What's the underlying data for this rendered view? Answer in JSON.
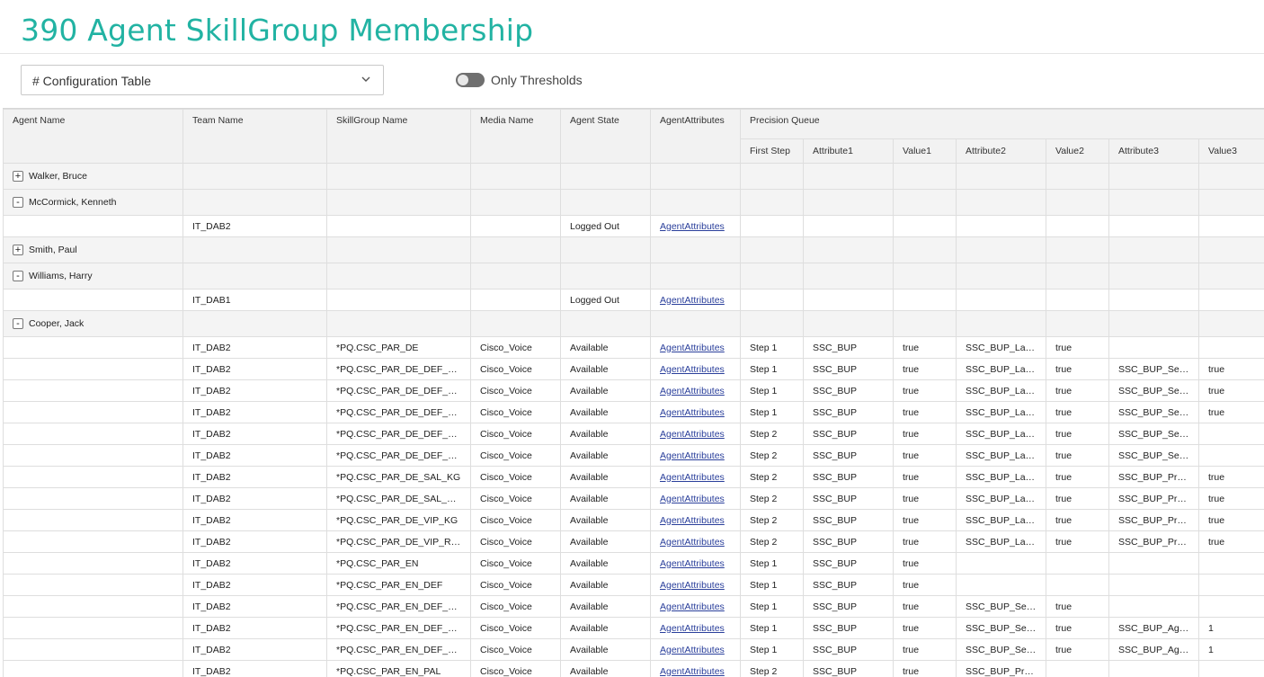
{
  "page": {
    "title": "390 Agent SkillGroup Membership",
    "dropdown_value": "# Configuration Table",
    "toggle_label": "Only Thresholds"
  },
  "colors": {
    "title": "#22b3a3",
    "link": "#2a3f9b",
    "toggle_track": "#6f6f6f"
  },
  "table": {
    "headers": {
      "agent_name": "Agent Name",
      "team_name": "Team Name",
      "skillgroup_name": "SkillGroup Name",
      "media_name": "Media Name",
      "agent_state": "Agent State",
      "agent_attributes": "AgentAttributes",
      "precision_queue": "Precision Queue",
      "sub": [
        "First Step",
        "Attribute1",
        "Value1",
        "Attribute2",
        "Value2",
        "Attribute3",
        "Value3"
      ]
    },
    "rows": [
      {
        "type": "group",
        "expander": "+",
        "name": "Walker, Bruce"
      },
      {
        "type": "group",
        "expander": "-",
        "name": "McCormick, Kenneth"
      },
      {
        "type": "data",
        "cells": [
          "",
          "IT_DAB2",
          "",
          "",
          "Logged Out",
          "AgentAttributes",
          "",
          "",
          "",
          "",
          "",
          "",
          ""
        ]
      },
      {
        "type": "group",
        "expander": "+",
        "name": "Smith, Paul"
      },
      {
        "type": "group",
        "expander": "-",
        "name": "Williams, Harry"
      },
      {
        "type": "data",
        "cells": [
          "",
          "IT_DAB1",
          "",
          "",
          "Logged Out",
          "AgentAttributes",
          "",
          "",
          "",
          "",
          "",
          "",
          ""
        ]
      },
      {
        "type": "group",
        "expander": "-",
        "name": "Cooper, Jack"
      },
      {
        "type": "data",
        "cells": [
          "",
          "IT_DAB2",
          "*PQ.CSC_PAR_DE",
          "Cisco_Voice",
          "Available",
          "AgentAttributes",
          "Step 1",
          "SSC_BUP",
          "true",
          "SSC_BUP_Langu...",
          "true",
          "",
          ""
        ]
      },
      {
        "type": "data",
        "cells": [
          "",
          "IT_DAB2",
          "*PQ.CSC_PAR_DE_DEF_DAB",
          "Cisco_Voice",
          "Available",
          "AgentAttributes",
          "Step 1",
          "SSC_BUP",
          "true",
          "SSC_BUP_Langu...",
          "true",
          "SSC_BUP_Servic...",
          "true"
        ]
      },
      {
        "type": "data",
        "cells": [
          "",
          "IT_DAB2",
          "*PQ.CSC_PAR_DE_DEF_DAB...",
          "Cisco_Voice",
          "Available",
          "AgentAttributes",
          "Step 1",
          "SSC_BUP",
          "true",
          "SSC_BUP_Langu...",
          "true",
          "SSC_BUP_Servic...",
          "true"
        ]
      },
      {
        "type": "data",
        "cells": [
          "",
          "IT_DAB2",
          "*PQ.CSC_PAR_DE_DEF_DAB...",
          "Cisco_Voice",
          "Available",
          "AgentAttributes",
          "Step 1",
          "SSC_BUP",
          "true",
          "SSC_BUP_Langu...",
          "true",
          "SSC_BUP_Servic...",
          "true"
        ]
      },
      {
        "type": "data",
        "cells": [
          "",
          "IT_DAB2",
          "*PQ.CSC_PAR_DE_DEF_KG",
          "Cisco_Voice",
          "Available",
          "AgentAttributes",
          "Step 2",
          "SSC_BUP",
          "true",
          "SSC_BUP_Langu...",
          "true",
          "SSC_BUP_Servic...",
          ""
        ]
      },
      {
        "type": "data",
        "cells": [
          "",
          "IT_DAB2",
          "*PQ.CSC_PAR_DE_DEF_RGR",
          "Cisco_Voice",
          "Available",
          "AgentAttributes",
          "Step 2",
          "SSC_BUP",
          "true",
          "SSC_BUP_Langu...",
          "true",
          "SSC_BUP_Servic...",
          ""
        ]
      },
      {
        "type": "data",
        "cells": [
          "",
          "IT_DAB2",
          "*PQ.CSC_PAR_DE_SAL_KG",
          "Cisco_Voice",
          "Available",
          "AgentAttributes",
          "Step 2",
          "SSC_BUP",
          "true",
          "SSC_BUP_Langu...",
          "true",
          "SSC_BUP_Profile...",
          "true"
        ]
      },
      {
        "type": "data",
        "cells": [
          "",
          "IT_DAB2",
          "*PQ.CSC_PAR_DE_SAL_RGR",
          "Cisco_Voice",
          "Available",
          "AgentAttributes",
          "Step 2",
          "SSC_BUP",
          "true",
          "SSC_BUP_Langu...",
          "true",
          "SSC_BUP_Profile...",
          "true"
        ]
      },
      {
        "type": "data",
        "cells": [
          "",
          "IT_DAB2",
          "*PQ.CSC_PAR_DE_VIP_KG",
          "Cisco_Voice",
          "Available",
          "AgentAttributes",
          "Step 2",
          "SSC_BUP",
          "true",
          "SSC_BUP_Langu...",
          "true",
          "SSC_BUP_Profile...",
          "true"
        ]
      },
      {
        "type": "data",
        "cells": [
          "",
          "IT_DAB2",
          "*PQ.CSC_PAR_DE_VIP_RGR",
          "Cisco_Voice",
          "Available",
          "AgentAttributes",
          "Step 2",
          "SSC_BUP",
          "true",
          "SSC_BUP_Langu...",
          "true",
          "SSC_BUP_Profile...",
          "true"
        ]
      },
      {
        "type": "data",
        "cells": [
          "",
          "IT_DAB2",
          "*PQ.CSC_PAR_EN",
          "Cisco_Voice",
          "Available",
          "AgentAttributes",
          "Step 1",
          "SSC_BUP",
          "true",
          "",
          "",
          "",
          ""
        ]
      },
      {
        "type": "data",
        "cells": [
          "",
          "IT_DAB2",
          "*PQ.CSC_PAR_EN_DEF",
          "Cisco_Voice",
          "Available",
          "AgentAttributes",
          "Step 1",
          "SSC_BUP",
          "true",
          "",
          "",
          "",
          ""
        ]
      },
      {
        "type": "data",
        "cells": [
          "",
          "IT_DAB2",
          "*PQ.CSC_PAR_EN_DEF_DAB",
          "Cisco_Voice",
          "Available",
          "AgentAttributes",
          "Step 1",
          "SSC_BUP",
          "true",
          "SSC_BUP_Servic...",
          "true",
          "",
          ""
        ]
      },
      {
        "type": "data",
        "cells": [
          "",
          "IT_DAB2",
          "*PQ.CSC_PAR_EN_DEF_DAB...",
          "Cisco_Voice",
          "Available",
          "AgentAttributes",
          "Step 1",
          "SSC_BUP",
          "true",
          "SSC_BUP_Servic...",
          "true",
          "SSC_BUP_AgtGr...",
          "1"
        ]
      },
      {
        "type": "data",
        "cells": [
          "",
          "IT_DAB2",
          "*PQ.CSC_PAR_EN_DEF_DAB...",
          "Cisco_Voice",
          "Available",
          "AgentAttributes",
          "Step 1",
          "SSC_BUP",
          "true",
          "SSC_BUP_Servic...",
          "true",
          "SSC_BUP_AgtGr...",
          "1"
        ]
      },
      {
        "type": "data",
        "cells": [
          "",
          "IT_DAB2",
          "*PQ.CSC_PAR_EN_PAL",
          "Cisco_Voice",
          "Available",
          "AgentAttributes",
          "Step 2",
          "SSC_BUP",
          "true",
          "SSC_BUP_Profile...",
          "",
          "",
          ""
        ]
      }
    ]
  }
}
